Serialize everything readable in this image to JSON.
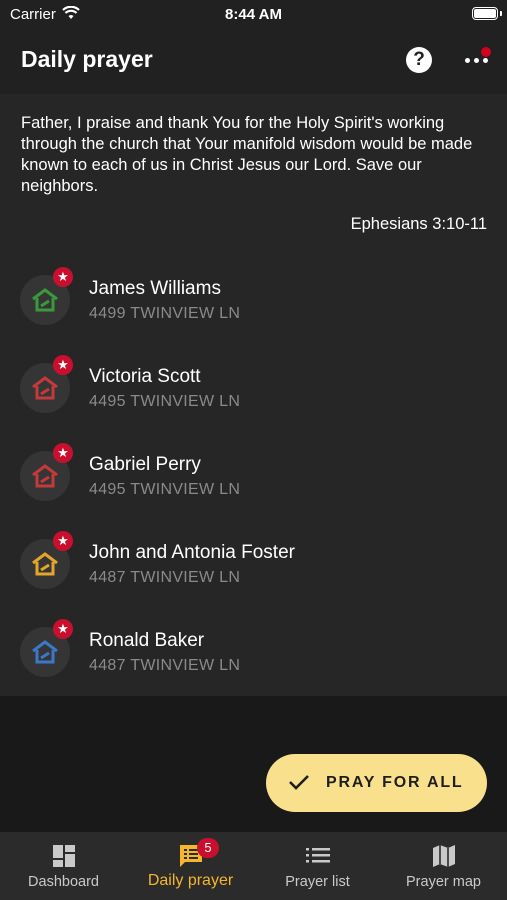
{
  "status_bar": {
    "carrier": "Carrier",
    "time": "8:44 AM"
  },
  "header": {
    "title": "Daily prayer"
  },
  "prayer": {
    "text": "Father, I praise and thank You for the Holy Spirit's working through the church that Your manifold wisdom would be made known to each of us in Christ Jesus our Lord. Save our neighbors.",
    "reference": "Ephesians 3:10-11"
  },
  "neighbors": [
    {
      "name": "James Williams",
      "address": "4499 TWINVIEW LN",
      "house_color": "#3a9a3a"
    },
    {
      "name": "Victoria Scott",
      "address": "4495 TWINVIEW LN",
      "house_color": "#c43a3a"
    },
    {
      "name": "Gabriel Perry",
      "address": "4495 TWINVIEW LN",
      "house_color": "#c43a3a"
    },
    {
      "name": "John and Antonia Foster",
      "address": "4487 TWINVIEW LN",
      "house_color": "#e5a52a"
    },
    {
      "name": "Ronald Baker",
      "address": "4487 TWINVIEW LN",
      "house_color": "#3a78c8"
    }
  ],
  "fab": {
    "label": "PRAY FOR ALL"
  },
  "nav": {
    "tabs": [
      {
        "label": "Dashboard",
        "icon": "dashboard-icon"
      },
      {
        "label": "Daily prayer",
        "icon": "daily-prayer-icon",
        "badge": "5",
        "active": true
      },
      {
        "label": "Prayer list",
        "icon": "list-icon"
      },
      {
        "label": "Prayer map",
        "icon": "map-icon"
      }
    ]
  },
  "colors": {
    "accent": "#f5b52c",
    "fab": "#f9e08d",
    "badge": "#c8102e"
  }
}
